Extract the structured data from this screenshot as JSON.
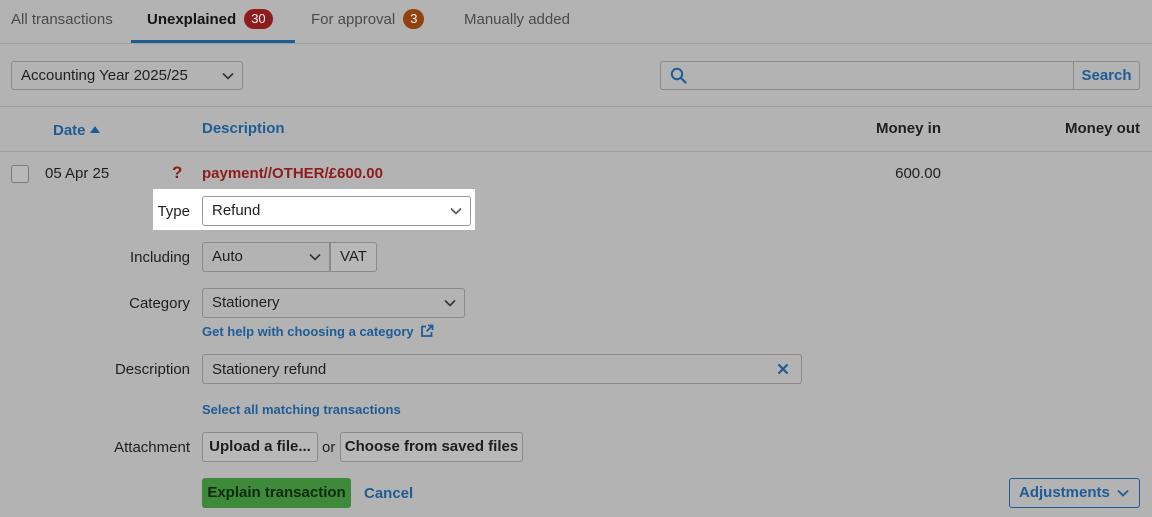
{
  "tabs": [
    {
      "label": "All transactions"
    },
    {
      "label": "Unexplained",
      "count": "30"
    },
    {
      "label": "For approval",
      "count": "3"
    },
    {
      "label": "Manually added"
    }
  ],
  "filters": {
    "year": "Accounting Year 2025/25",
    "search_button": "Search",
    "search_value": ""
  },
  "columns": {
    "date": "Date",
    "description": "Description",
    "money_in": "Money in",
    "money_out": "Money out"
  },
  "transaction": {
    "date": "05 Apr 25",
    "status_icon": "?",
    "description": "payment//OTHER/£600.00",
    "money_in": "600.00",
    "money_out": ""
  },
  "form": {
    "type_label": "Type",
    "type_value": "Refund",
    "including_label": "Including",
    "including_value": "Auto",
    "vat_label": "VAT",
    "category_label": "Category",
    "category_value": "Stationery",
    "category_help": "Get help with choosing a category",
    "description_label": "Description",
    "description_value": "Stationery refund",
    "select_matching": "Select all matching transactions",
    "attachment_label": "Attachment",
    "upload_button": "Upload a file...",
    "or_text": "or",
    "choose_button": "Choose from saved files",
    "explain_button": "Explain transaction",
    "cancel_link": "Cancel",
    "adjustments_button": "Adjustments"
  },
  "colors": {
    "link": "#1f5c96",
    "danger": "#8e1c1c",
    "primary_button": "#3f8a3a"
  }
}
